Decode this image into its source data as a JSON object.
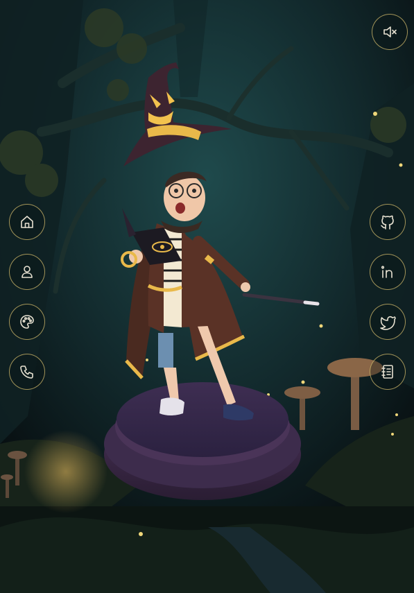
{
  "sound_toggle": {
    "icon": "speaker-muted-icon",
    "state": "muted"
  },
  "left_nav": {
    "items": [
      {
        "id": "home",
        "icon": "home-icon"
      },
      {
        "id": "about",
        "icon": "user-icon"
      },
      {
        "id": "projects",
        "icon": "palette-icon"
      },
      {
        "id": "contact",
        "icon": "phone-icon"
      }
    ]
  },
  "right_nav": {
    "items": [
      {
        "id": "github",
        "icon": "github-icon"
      },
      {
        "id": "linkedin",
        "icon": "linkedin-icon"
      },
      {
        "id": "twitter",
        "icon": "twitter-icon"
      },
      {
        "id": "notebook",
        "icon": "notebook-icon"
      }
    ]
  },
  "colors": {
    "background": "#0b1416",
    "button_border": "#d6be6e",
    "icon_stroke": "#e8e2d2",
    "robe": "#5a3226",
    "hat": "#3d2430",
    "trim": "#e9b94a",
    "pedestal": "#3a2c48"
  }
}
